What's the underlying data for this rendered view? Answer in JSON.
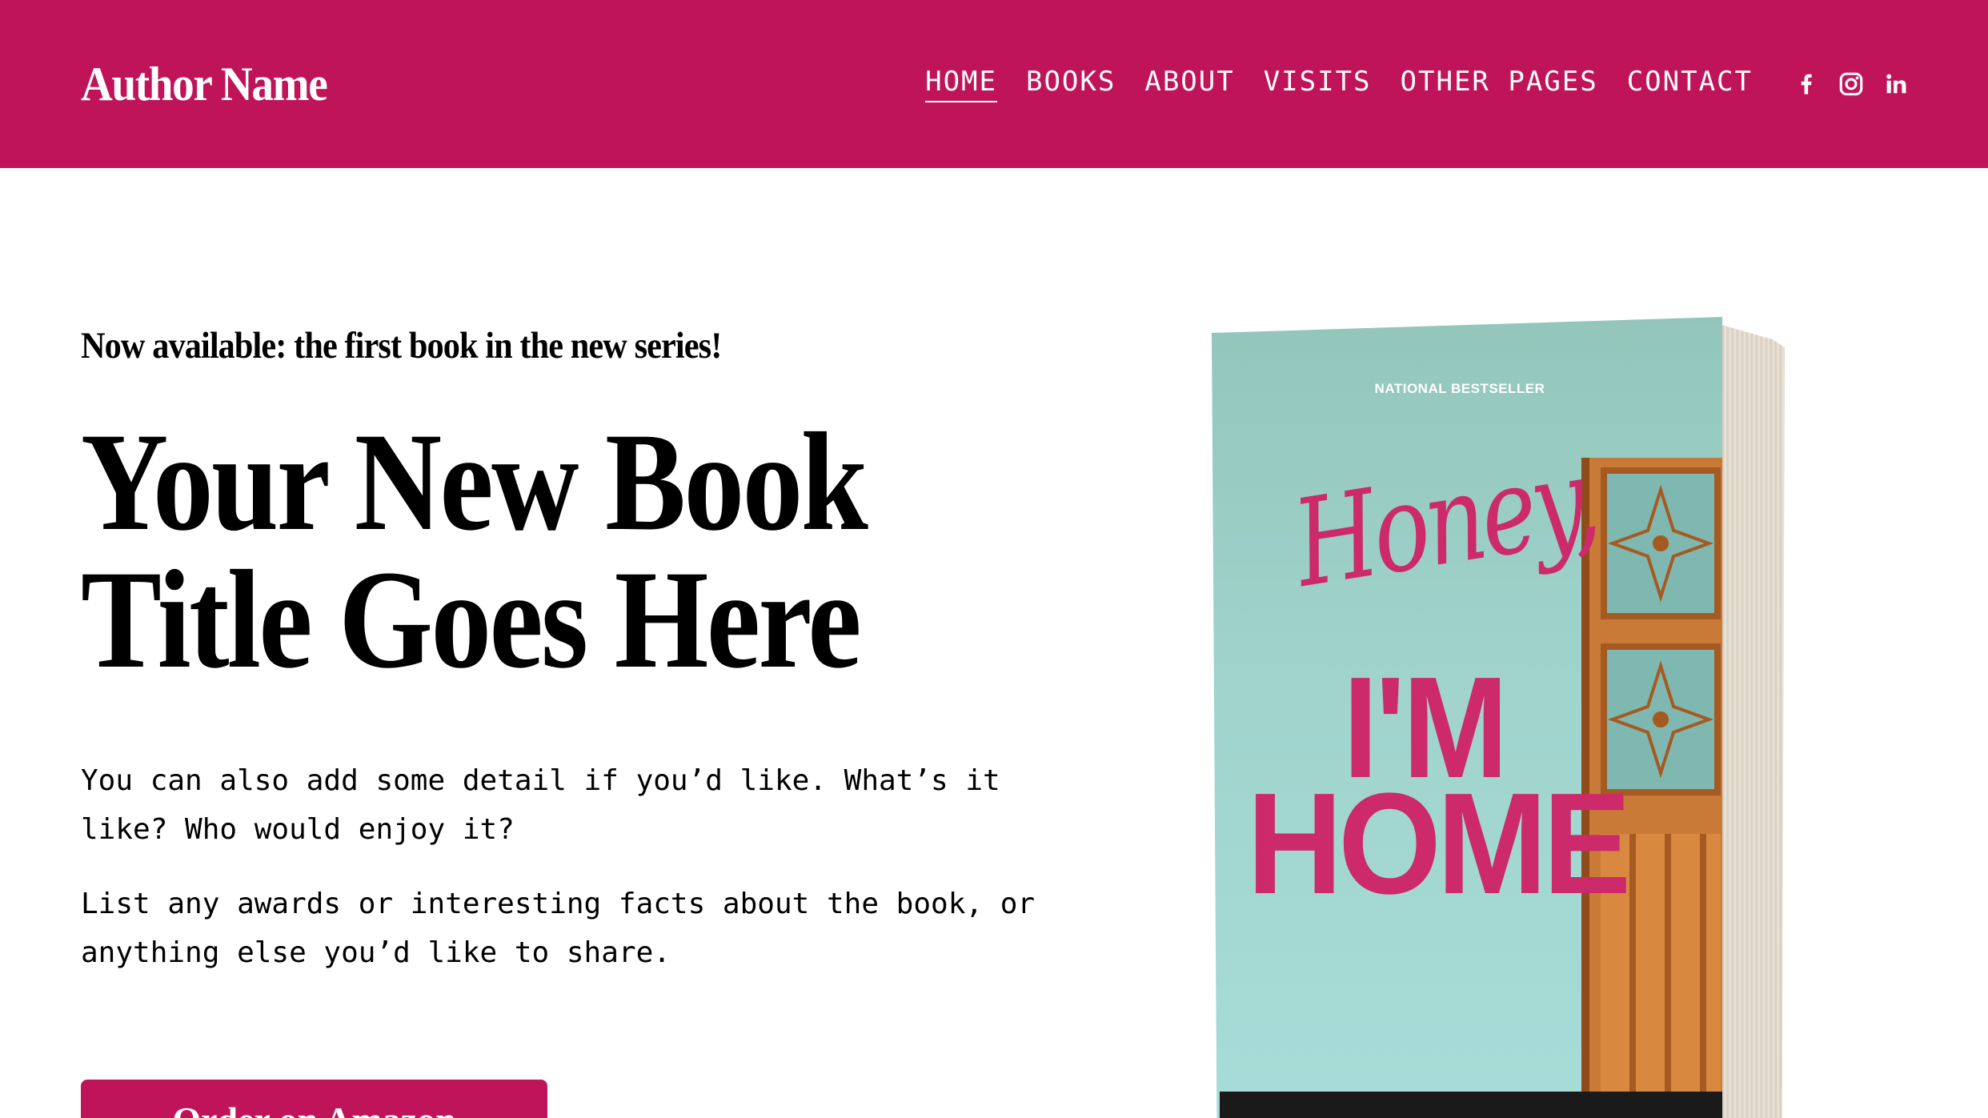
{
  "header": {
    "site_title": "Author Name",
    "nav": [
      {
        "label": "HOME",
        "active": true
      },
      {
        "label": "BOOKS",
        "active": false
      },
      {
        "label": "ABOUT",
        "active": false
      },
      {
        "label": "VISITS",
        "active": false
      },
      {
        "label": "OTHER PAGES",
        "active": false
      },
      {
        "label": "CONTACT",
        "active": false
      }
    ],
    "social": [
      "facebook-icon",
      "instagram-icon",
      "linkedin-icon"
    ]
  },
  "hero": {
    "kicker": "Now available: the first book in the new series!",
    "title_line1": "Your New Book",
    "title_line2": "Title Goes Here",
    "desc1": "You can also add some detail if you’d like. What’s it like? Who would enjoy it?",
    "desc2": "List any awards or interesting facts about the book, or anything else you’d like to share.",
    "button_label": "Order on Amazon"
  },
  "book_cover": {
    "badge": "NATIONAL BESTSELLER",
    "script_title": "Honey,",
    "title_line1": "I'M",
    "title_line2": "HOME"
  },
  "colors": {
    "brand": "#bf1459",
    "cover_bg": "#a1d6cf",
    "cover_title": "#cc2a6b"
  }
}
